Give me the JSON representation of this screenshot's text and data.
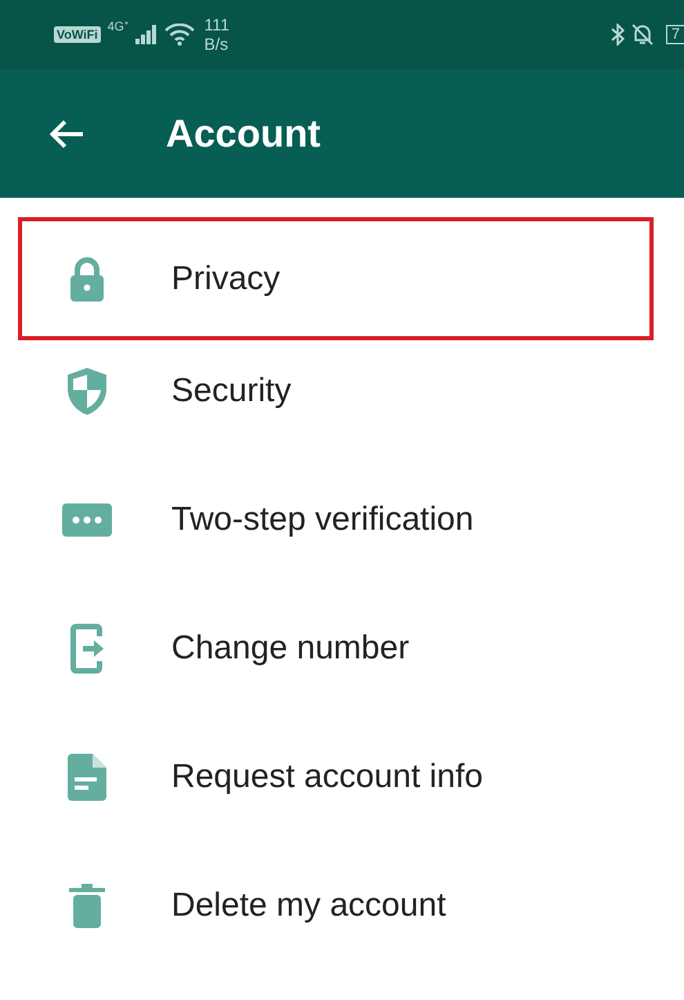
{
  "status_bar": {
    "wifi_calling": "VoWiFi",
    "network": "4G⁺",
    "speed_value": "111",
    "speed_unit": "B/s",
    "battery": "7"
  },
  "app_bar": {
    "title": "Account"
  },
  "items": [
    {
      "kind": "lock",
      "label": "Privacy",
      "highlighted": true
    },
    {
      "kind": "shield",
      "label": "Security",
      "highlighted": false
    },
    {
      "kind": "dots",
      "label": "Two-step verification",
      "highlighted": false
    },
    {
      "kind": "change",
      "label": "Change number",
      "highlighted": false
    },
    {
      "kind": "doc",
      "label": "Request account info",
      "highlighted": false
    },
    {
      "kind": "trash",
      "label": "Delete my account",
      "highlighted": false
    }
  ]
}
